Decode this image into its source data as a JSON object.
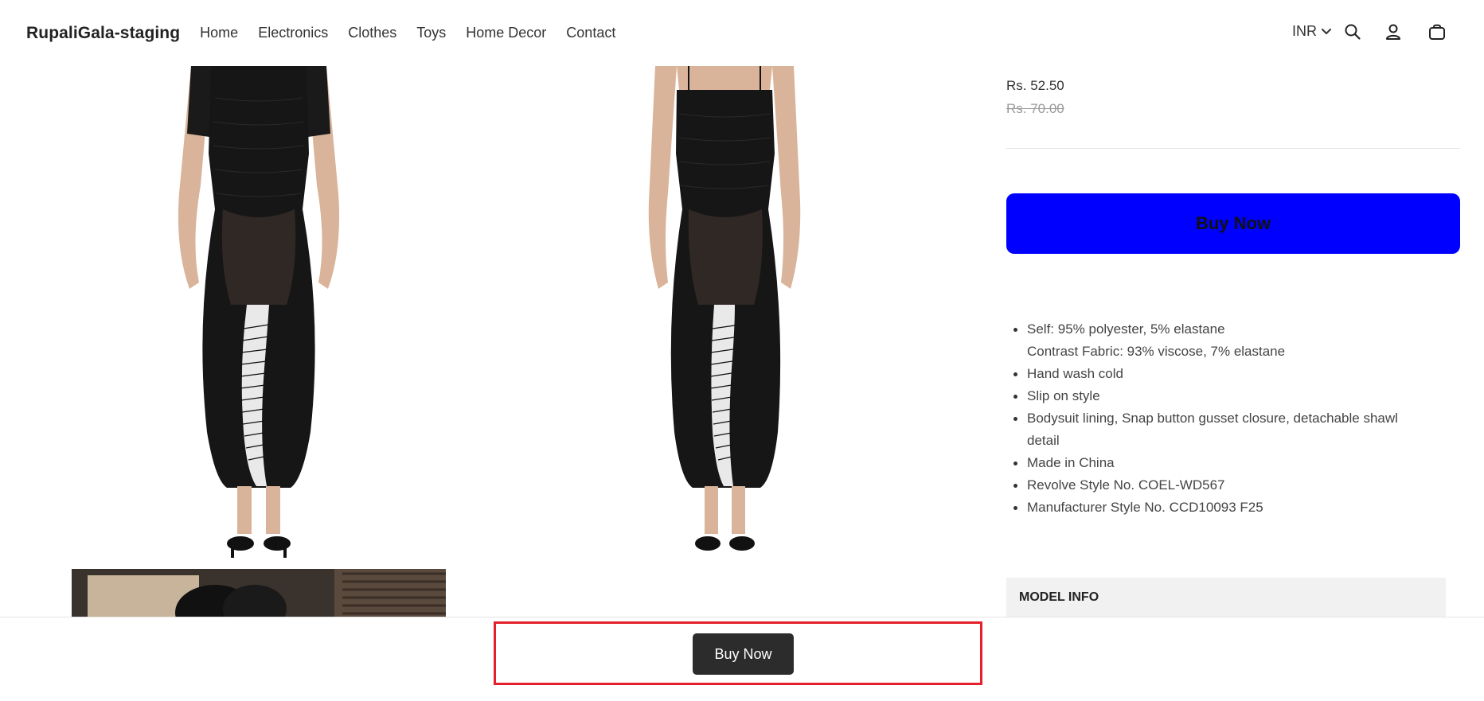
{
  "header": {
    "brand": "RupaliGala-staging",
    "nav": [
      "Home",
      "Electronics",
      "Clothes",
      "Toys",
      "Home Decor",
      "Contact"
    ],
    "currency": "INR",
    "icons": [
      "search-icon",
      "account-icon",
      "cart-icon"
    ]
  },
  "product": {
    "images": [
      "dress-front-1",
      "dress-front-2",
      "dress-lifestyle"
    ],
    "price": "Rs. 52.50",
    "compare_price": "Rs. 70.00",
    "buy_label": "Buy Now",
    "features": [
      "Self: 95% polyester, 5% elastane",
      "Contrast Fabric: 93% viscose, 7% elastane",
      "Hand wash cold",
      "Slip on style",
      "Bodysuit lining, Snap button gusset closure, detachable shawl detail",
      "Made in China",
      "Revolve Style No. COEL-WD567",
      "Manufacturer Style No. CCD10093 F25"
    ],
    "model_info_label": "MODEL INFO"
  },
  "sticky_bar": {
    "buy_label": "Buy Now"
  },
  "colors": {
    "buy_main_bg": "#0000ff",
    "sticky_button_bg": "#2c2c2c",
    "highlight": "#e3202b"
  }
}
